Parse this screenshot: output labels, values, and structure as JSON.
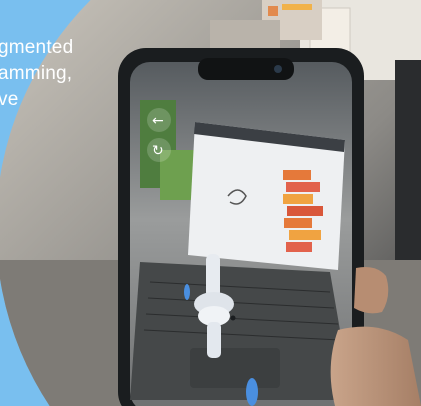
{
  "caption": {
    "lines": [
      "gmented",
      "amming,",
      "ve"
    ]
  },
  "photo_subject": {
    "overlay_arrow_glyph": "←",
    "overlay_rotate_glyph": "↻"
  },
  "colors": {
    "panel_blue": "#79bfef",
    "caption_text": "#ffffff",
    "phone_body": "#1a1d1f"
  }
}
